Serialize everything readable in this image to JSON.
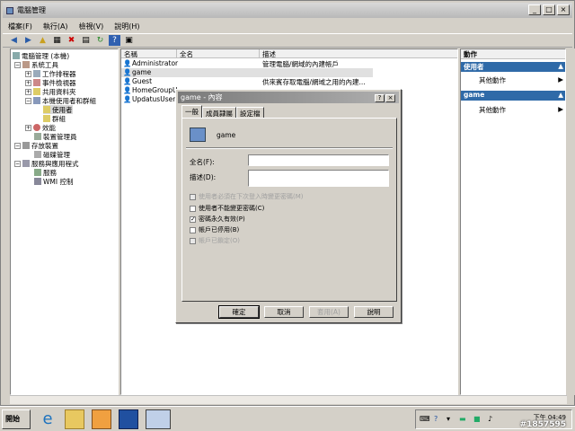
{
  "window": {
    "title": "電腦管理"
  },
  "menu": [
    "檔案(F)",
    "執行(A)",
    "檢視(V)",
    "說明(H)"
  ],
  "tree": [
    {
      "label": "電腦管理 (本機)",
      "indent": 0,
      "expander": ""
    },
    {
      "label": "系統工具",
      "indent": 1,
      "expander": "−"
    },
    {
      "label": "工作排程器",
      "indent": 2,
      "expander": "+"
    },
    {
      "label": "事件檢視器",
      "indent": 2,
      "expander": "+"
    },
    {
      "label": "共用資料夾",
      "indent": 2,
      "expander": "+"
    },
    {
      "label": "本機使用者和群組",
      "indent": 2,
      "expander": "−"
    },
    {
      "label": "使用者",
      "indent": 3,
      "expander": ""
    },
    {
      "label": "群組",
      "indent": 3,
      "expander": ""
    },
    {
      "label": "效能",
      "indent": 2,
      "expander": "+"
    },
    {
      "label": "裝置管理員",
      "indent": 2,
      "expander": ""
    },
    {
      "label": "存放裝置",
      "indent": 1,
      "expander": "−"
    },
    {
      "label": "磁碟管理",
      "indent": 2,
      "expander": ""
    },
    {
      "label": "服務與應用程式",
      "indent": 1,
      "expander": "−"
    },
    {
      "label": "服務",
      "indent": 2,
      "expander": ""
    },
    {
      "label": "WMI 控制",
      "indent": 2,
      "expander": ""
    }
  ],
  "list": {
    "columns": [
      "名稱",
      "全名",
      "描述"
    ],
    "rows": [
      {
        "name": "Administrator",
        "fullname": "",
        "desc": "管理電腦/網域的內建帳戶"
      },
      {
        "name": "game",
        "fullname": "",
        "desc": ""
      },
      {
        "name": "Guest",
        "fullname": "",
        "desc": "供來賓存取電腦/網域之用的內建..."
      },
      {
        "name": "HomeGroupU...",
        "fullname": "",
        "desc": ""
      },
      {
        "name": "UpdatusUser",
        "fullname": "",
        "desc": ""
      }
    ]
  },
  "actions": {
    "title": "動作",
    "sections": [
      {
        "header": "使用者",
        "item": "其他動作"
      },
      {
        "header": "game",
        "item": "其他動作"
      }
    ]
  },
  "dialog": {
    "title": "game - 內容",
    "tabs": [
      "一般",
      "成員隸屬",
      "設定檔"
    ],
    "username": "game",
    "fullname_label": "全名(F):",
    "desc_label": "描述(D):",
    "fullname_value": "",
    "desc_value": "",
    "checkboxes": [
      {
        "label": "使用者必須在下次登入時變更密碼(M)",
        "checked": false,
        "disabled": true
      },
      {
        "label": "使用者不能變更密碼(C)",
        "checked": false,
        "disabled": false
      },
      {
        "label": "密碼永久有效(P)",
        "checked": true,
        "disabled": false
      },
      {
        "label": "帳戶已停用(B)",
        "checked": false,
        "disabled": false
      },
      {
        "label": "帳戶已鎖定(O)",
        "checked": false,
        "disabled": true
      }
    ],
    "buttons": {
      "ok": "確定",
      "cancel": "取消",
      "apply": "套用(A)",
      "help": "說明"
    }
  },
  "taskbar": {
    "start": "開始",
    "clock": "下午 04:49",
    "watermark": "#1857595"
  }
}
